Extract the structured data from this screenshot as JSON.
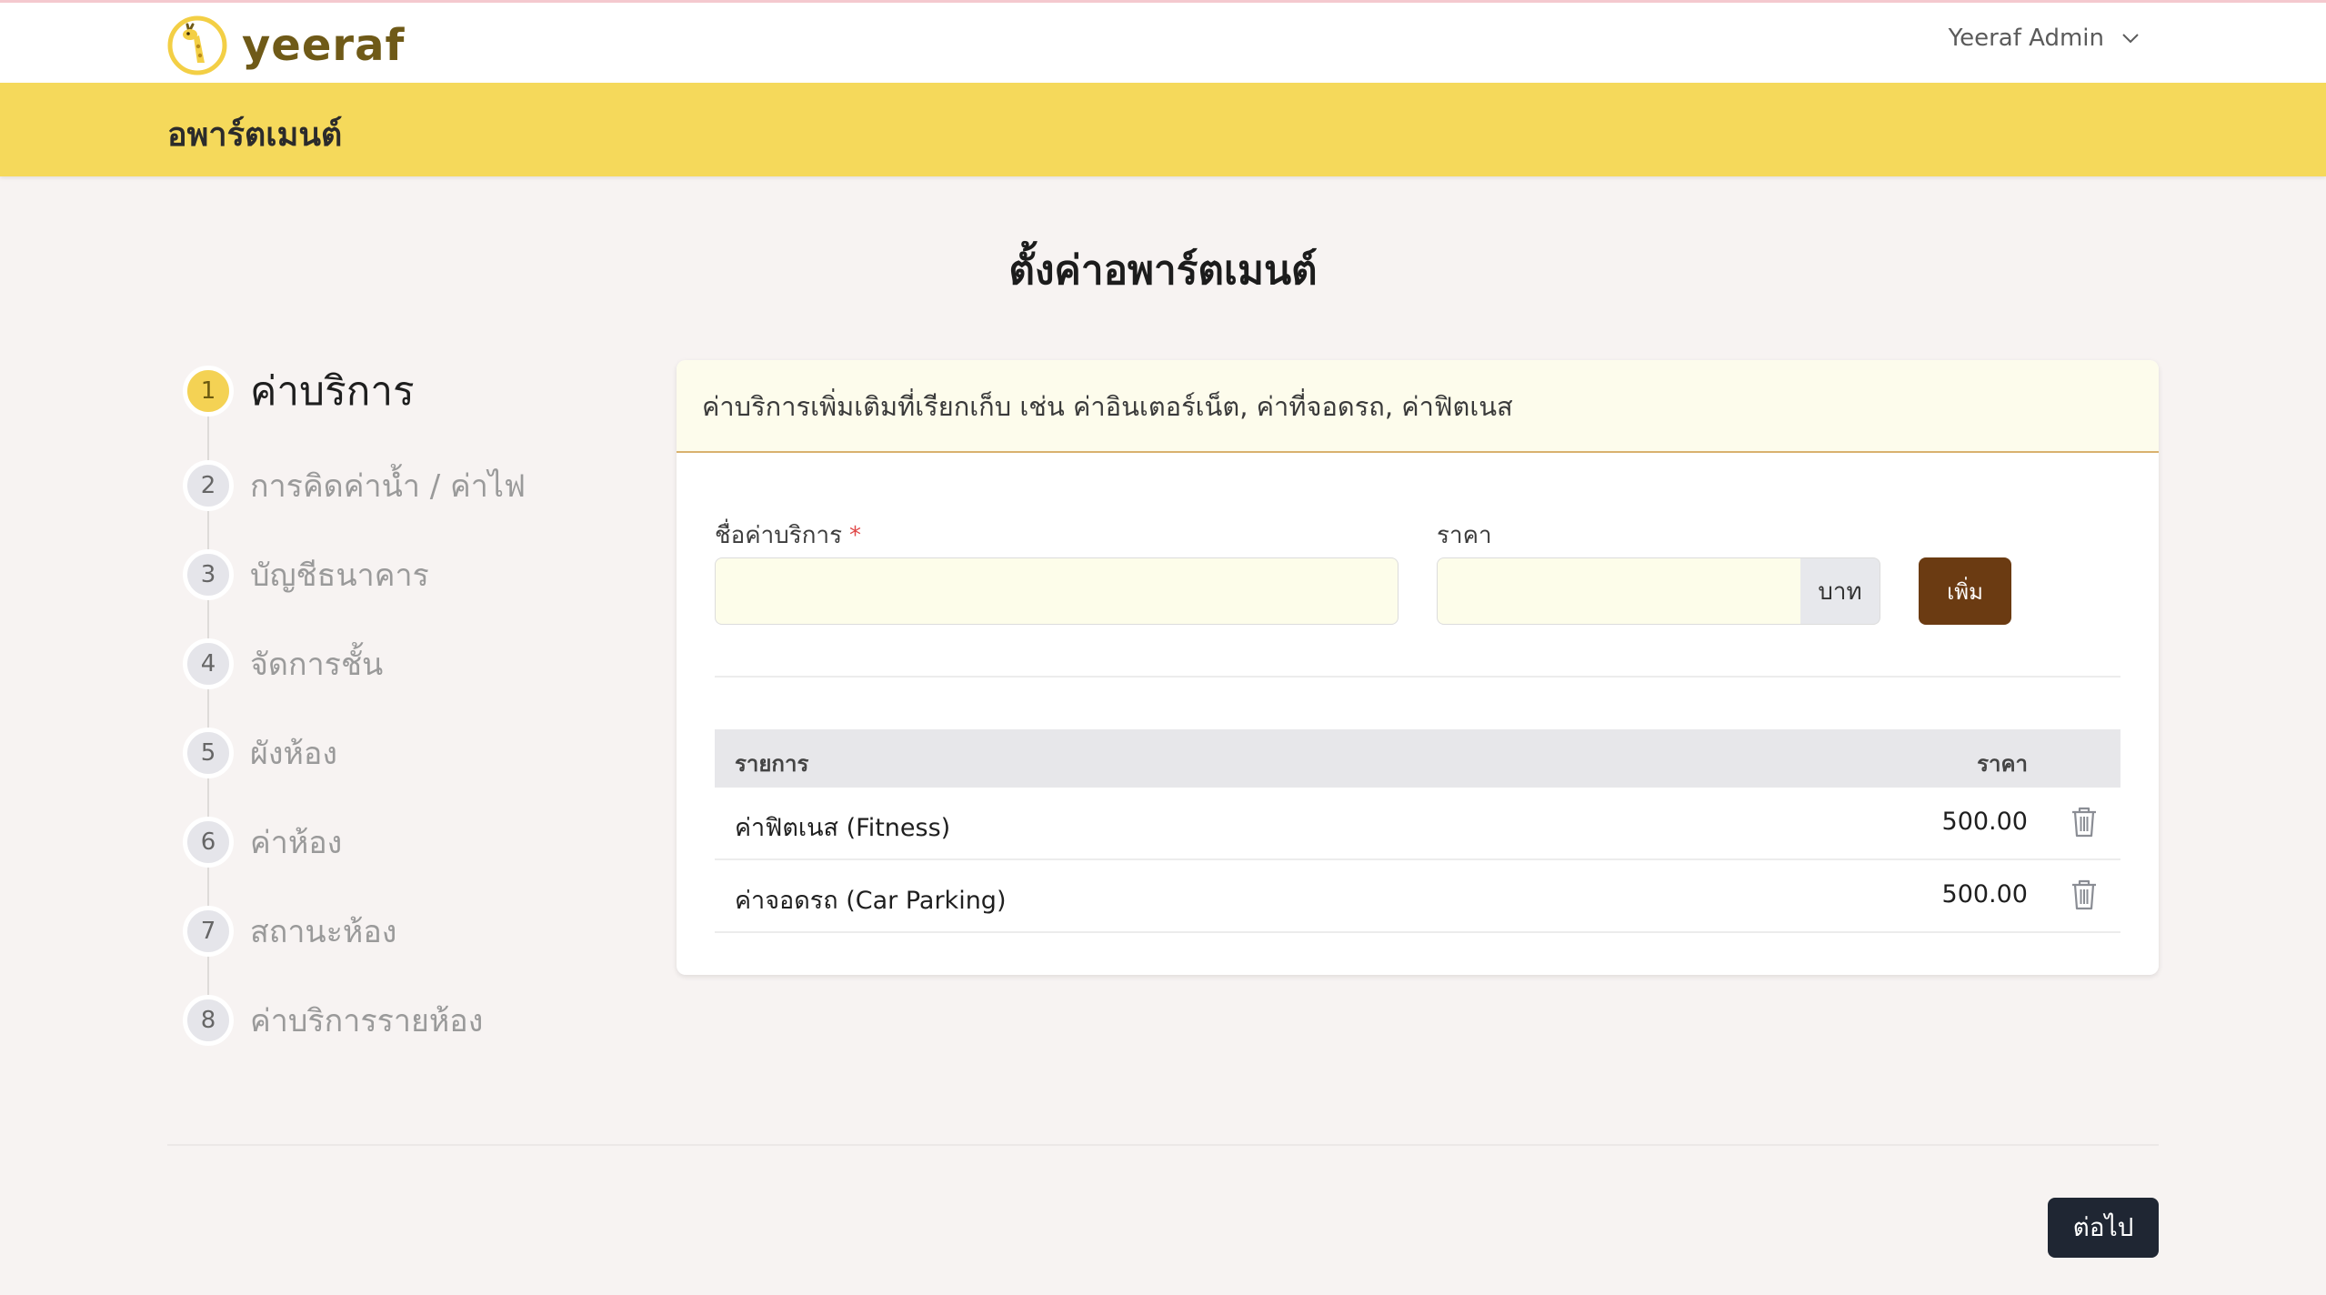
{
  "app": {
    "logo_text": "yeeraf",
    "user_name": "Yeeraf Admin"
  },
  "banner": {
    "title": "อพาร์ตเมนต์"
  },
  "page": {
    "title": "ตั้งค่าอพาร์ตเมนต์"
  },
  "steps": [
    {
      "num": "1",
      "label": "ค่าบริการ"
    },
    {
      "num": "2",
      "label": "การคิดค่าน้ำ / ค่าไฟ"
    },
    {
      "num": "3",
      "label": "บัญชีธนาคาร"
    },
    {
      "num": "4",
      "label": "จัดการชั้น"
    },
    {
      "num": "5",
      "label": "ผังห้อง"
    },
    {
      "num": "6",
      "label": "ค่าห้อง"
    },
    {
      "num": "7",
      "label": "สถานะห้อง"
    },
    {
      "num": "8",
      "label": "ค่าบริการรายห้อง"
    }
  ],
  "form": {
    "description": "ค่าบริการเพิ่มเติมที่เรียกเก็บ เช่น ค่าอินเตอร์เน็ต, ค่าที่จอดรถ, ค่าฟิตเนส",
    "name_label": "ชื่อค่าบริการ",
    "required_mark": "*",
    "name_value": "",
    "price_label": "ราคา",
    "price_value": "",
    "currency": "บาท",
    "add_label": "เพิ่ม"
  },
  "table": {
    "headers": {
      "item": "รายการ",
      "price": "ราคา"
    },
    "rows": [
      {
        "item": "ค่าฟิตเนส (Fitness)",
        "price": "500.00"
      },
      {
        "item": "ค่าจอดรถ (Car Parking)",
        "price": "500.00"
      }
    ]
  },
  "footer": {
    "next_label": "ต่อไป"
  },
  "colors": {
    "banner": "#f5d95b",
    "accent_button": "#6b3b12",
    "next_button": "#1f2633",
    "active_step": "#f4d254"
  }
}
